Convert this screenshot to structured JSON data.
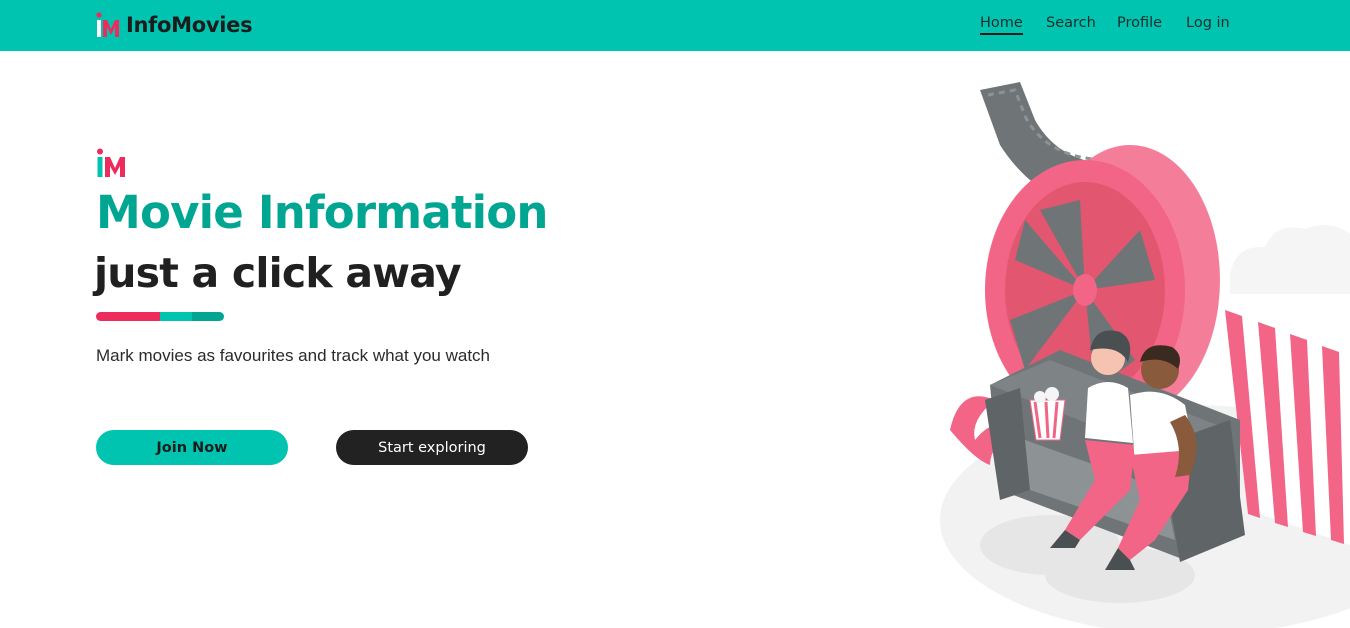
{
  "brand": {
    "logo_icon": "im-logo-icon",
    "name": "InfoMovies"
  },
  "nav": {
    "items": [
      {
        "label": "Home",
        "active": true
      },
      {
        "label": "Search",
        "active": false
      },
      {
        "label": "Profile",
        "active": false
      },
      {
        "label": "Log in",
        "active": false
      }
    ]
  },
  "hero": {
    "logo_icon": "im-logo-icon",
    "title": "Movie Information",
    "subtitle": "just a click away",
    "tagline": "Mark movies as favourites and track what you watch",
    "join_label": "Join Now",
    "explore_label": "Start exploring",
    "illustration": "couple-watching-movie-illustration"
  },
  "colors": {
    "primary": "#00c4b0",
    "primary_dark": "#00a692",
    "accent": "#ec2c5c",
    "dark": "#222222"
  }
}
